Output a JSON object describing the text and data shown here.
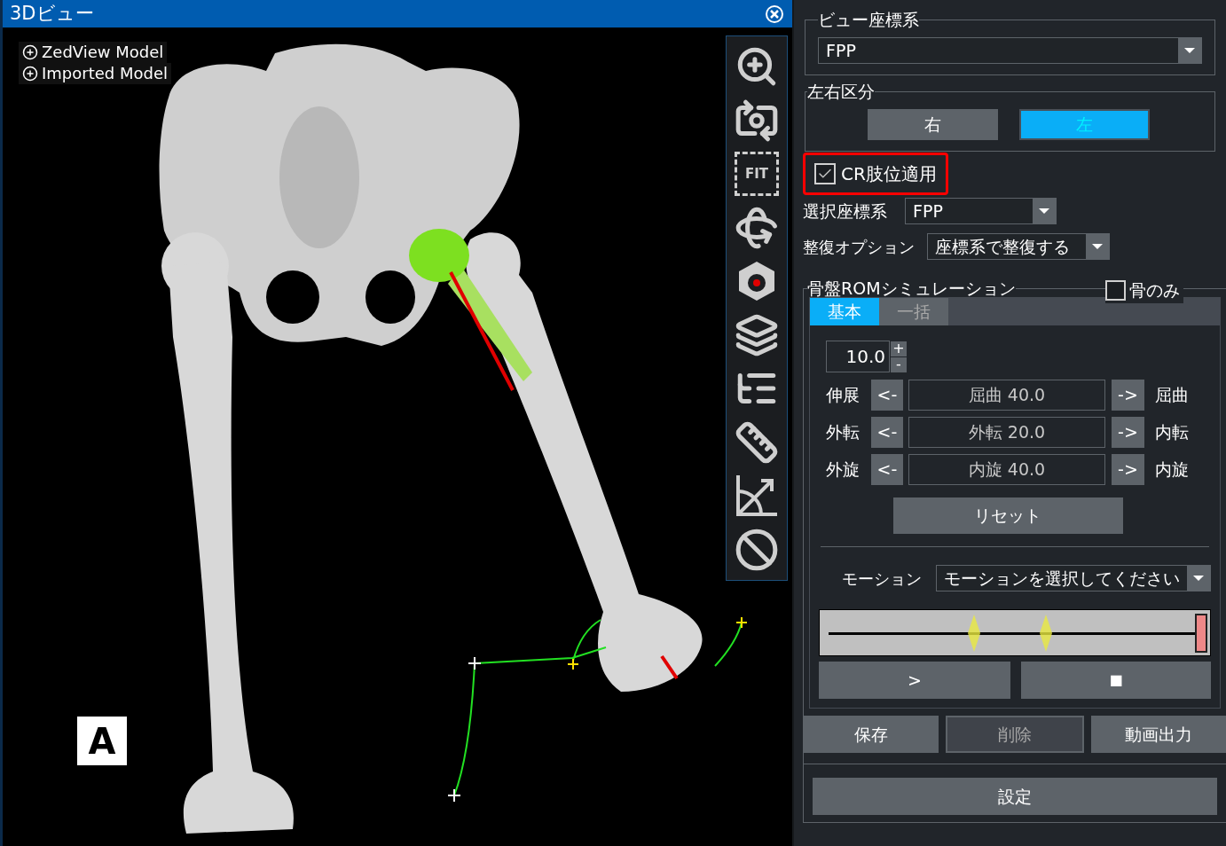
{
  "viewer": {
    "title": "3Dビュー",
    "tree": [
      {
        "label": "ZedView Model"
      },
      {
        "label": "Imported Model"
      }
    ],
    "corner_label": "A"
  },
  "toolbar": [
    {
      "kind": "zoom"
    },
    {
      "kind": "camera"
    },
    {
      "kind": "fit",
      "label": "FIT"
    },
    {
      "kind": "rotate"
    },
    {
      "kind": "center"
    },
    {
      "kind": "slices"
    },
    {
      "kind": "tree"
    },
    {
      "kind": "measure"
    },
    {
      "kind": "angle"
    },
    {
      "kind": "clear"
    }
  ],
  "panel": {
    "view_coords": {
      "legend": "ビュー座標系",
      "value": "FPP"
    },
    "side": {
      "legend": "左右区分",
      "options": [
        {
          "label": "右",
          "selected": false
        },
        {
          "label": "左",
          "selected": true
        }
      ]
    },
    "cr_limb": {
      "label": "CR肢位適用",
      "checked": true,
      "highlighted": true
    },
    "select_coords": {
      "label": "選択座標系",
      "value": "FPP"
    },
    "reduction": {
      "label": "整復オプション",
      "value": "座標系で整復する"
    },
    "rom": {
      "legend": "骨盤ROMシミュレーション",
      "bone_only": {
        "label": "骨のみ",
        "checked": false
      },
      "tabs": [
        {
          "label": "基本",
          "selected": true
        },
        {
          "label": "一括",
          "selected": false
        }
      ],
      "step": {
        "value": "10.0",
        "plus": "+",
        "minus": "-"
      },
      "rows": [
        {
          "left": "伸展",
          "dec": "<-",
          "reading": "屈曲 40.0",
          "inc": "->",
          "right": "屈曲"
        },
        {
          "left": "外転",
          "dec": "<-",
          "reading": "外転 20.0",
          "inc": "->",
          "right": "内転"
        },
        {
          "left": "外旋",
          "dec": "<-",
          "reading": "内旋 40.0",
          "inc": "->",
          "right": "内旋"
        }
      ],
      "reset": "リセット",
      "motion": {
        "label": "モーション",
        "value": "モーションを選択してください"
      },
      "timeline": {
        "level": 1
      },
      "play": ">",
      "stop": "■"
    },
    "actions": [
      {
        "label": "保存",
        "disabled": false
      },
      {
        "label": "削除",
        "disabled": true
      },
      {
        "label": "動画出力",
        "disabled": false
      }
    ],
    "settings": "設定"
  }
}
